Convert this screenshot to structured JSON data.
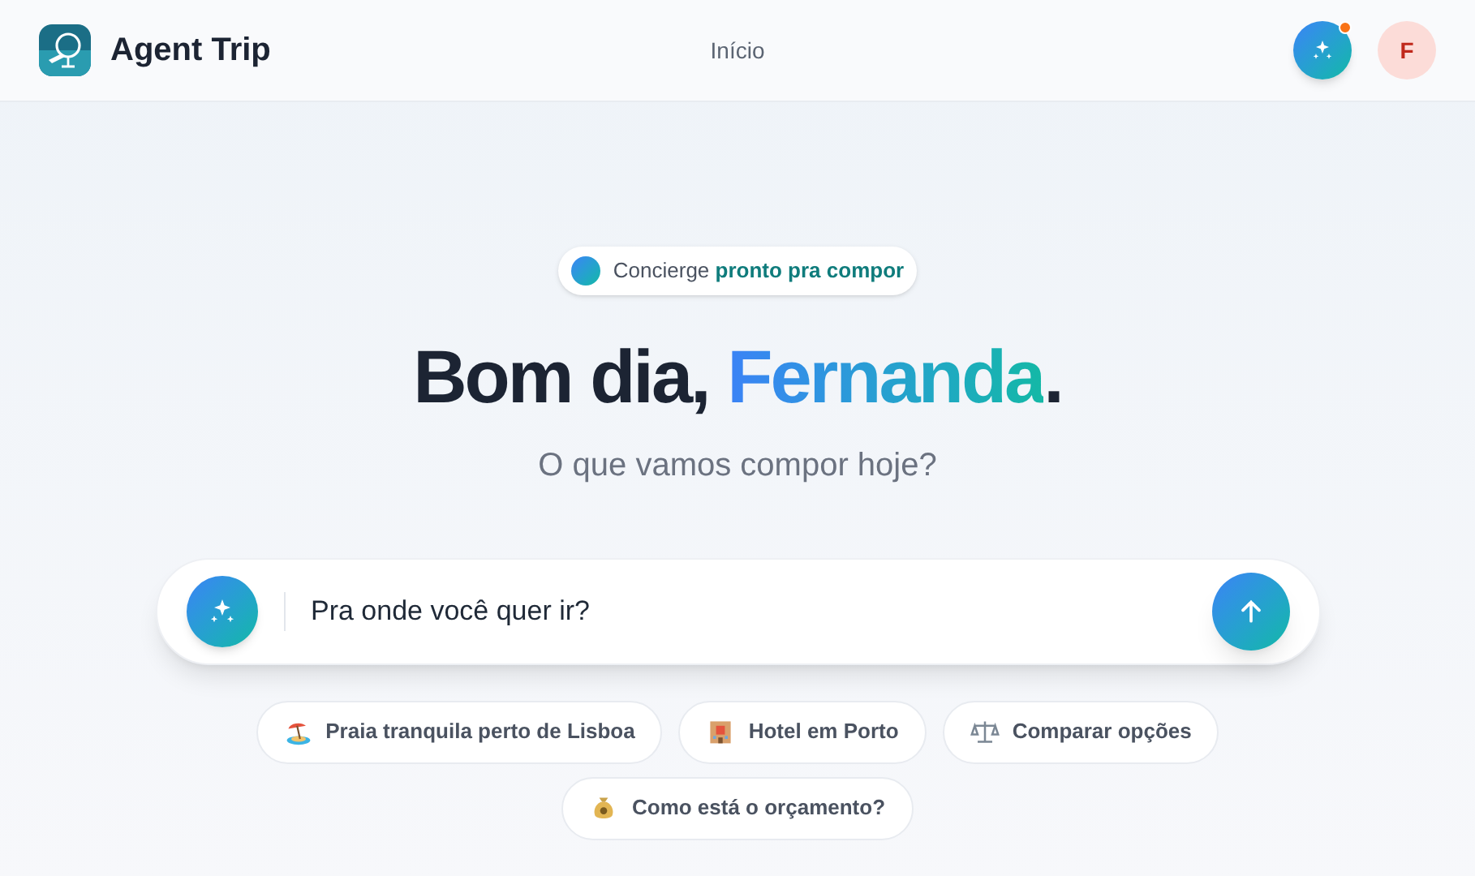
{
  "brand": {
    "name": "Agent Trip"
  },
  "nav": [
    {
      "label": "Início",
      "selected": false
    }
  ],
  "notifications": {
    "unread": true
  },
  "avatar": {
    "initial": "F"
  },
  "status_pill": {
    "label": "Concierge",
    "highlight": "pronto pra compor"
  },
  "headline": {
    "greeting": "Bom dia,",
    "name": "Fernanda",
    "end": "."
  },
  "subtitle": "O que vamos compor hoje?",
  "prompt": {
    "placeholder": "Pra onde você quer ir?"
  },
  "suggestions": [
    {
      "kind": "beach",
      "label": "Praia tranquila perto de Lisboa"
    },
    {
      "kind": "hotel",
      "label": "Hotel em Porto"
    },
    {
      "kind": "scale",
      "label": "Comparar opções"
    },
    {
      "kind": "money",
      "label": "Como está o orçamento?"
    }
  ]
}
